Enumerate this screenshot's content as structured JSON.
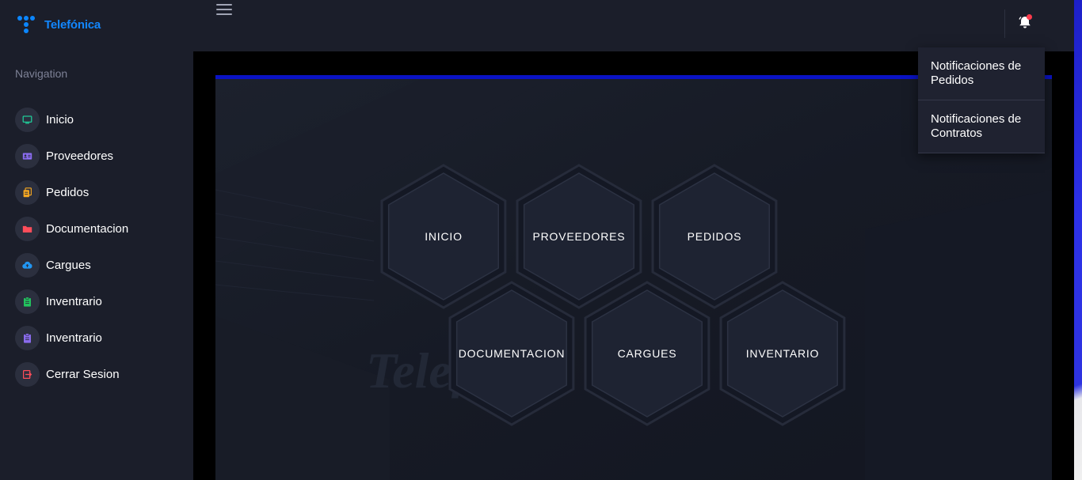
{
  "brand": {
    "name": "Telefónica",
    "color": "#0b86ff"
  },
  "sidebar": {
    "heading": "Navigation",
    "items": [
      {
        "label": "Inicio",
        "icon": "monitor-icon",
        "color": "#20c997"
      },
      {
        "label": "Proveedores",
        "icon": "id-card-icon",
        "color": "#8b6cf0"
      },
      {
        "label": "Pedidos",
        "icon": "file-copy-icon",
        "color": "#f7a821"
      },
      {
        "label": "Documentacion",
        "icon": "folder-icon",
        "color": "#ff4d5a"
      },
      {
        "label": "Cargues",
        "icon": "cloud-upload-icon",
        "color": "#2196f3"
      },
      {
        "label": "Inventrario",
        "icon": "clipboard-icon",
        "color": "#22c55e"
      },
      {
        "label": "Inventrario",
        "icon": "clipboard-icon",
        "color": "#8b6cf0"
      },
      {
        "label": "Cerrar Sesion",
        "icon": "logout-icon",
        "color": "#ff4d5a"
      }
    ]
  },
  "topbar": {
    "notification_badge_color": "#ff3b4c"
  },
  "notifications": {
    "items": [
      "Notificaciones de Pedidos",
      "Notificaciones de Contratos"
    ]
  },
  "hexagons": {
    "row1": [
      "INICIO",
      "PROVEEDORES",
      "PEDIDOS"
    ],
    "row2": [
      "DOCUMENTACION",
      "CARGUES",
      "INVENTARIO"
    ]
  },
  "colors": {
    "accent_bar": "#0a13c4",
    "hex_fill": "#1e2332"
  }
}
